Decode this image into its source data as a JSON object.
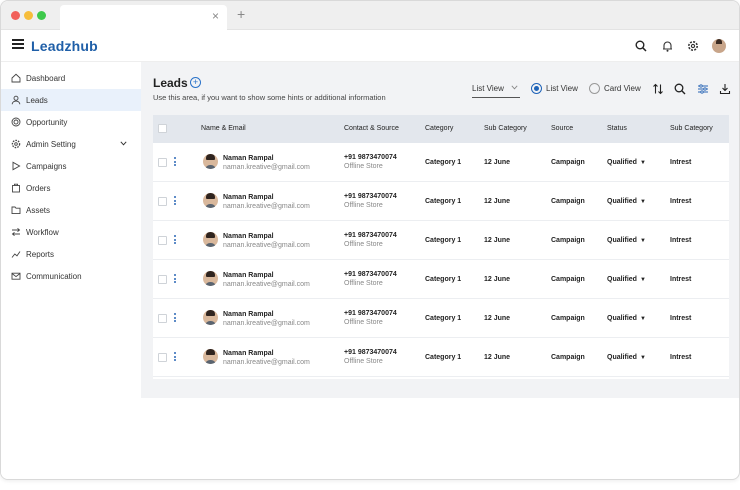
{
  "browser": {
    "dots": [
      "#f1605a",
      "#f6bd3b",
      "#3ec94b"
    ],
    "tab_close": "×",
    "new_tab": "+"
  },
  "app": {
    "logo": "Leadzhub",
    "top_icons": [
      "search-icon",
      "bell-icon",
      "gear-icon",
      "user-avatar"
    ]
  },
  "sidebar": {
    "items": [
      {
        "label": "Dashboard",
        "icon": "home-icon"
      },
      {
        "label": "Leads",
        "icon": "user-icon",
        "active": true
      },
      {
        "label": "Opportunity",
        "icon": "target-icon"
      },
      {
        "label": "Admin Setting",
        "icon": "gear-icon",
        "expandable": true
      },
      {
        "label": "Campaigns",
        "icon": "play-icon"
      },
      {
        "label": "Orders",
        "icon": "box-icon"
      },
      {
        "label": "Assets",
        "icon": "folder-icon"
      },
      {
        "label": "Workflow",
        "icon": "arrows-icon"
      },
      {
        "label": "Reports",
        "icon": "chart-icon"
      },
      {
        "label": "Communication",
        "icon": "mail-icon"
      }
    ]
  },
  "page": {
    "title": "Leads",
    "hint": "Use this area, if you want to show some hints or additional information",
    "view_select": "List View",
    "radio_list": "List View",
    "radio_card": "Card View",
    "selected_view": "list"
  },
  "table": {
    "headers": [
      "Name & Email",
      "Contact & Source",
      "Category",
      "Sub Category",
      "Source",
      "Status",
      "Sub Category"
    ],
    "rows": [
      {
        "name": "Naman Rampal",
        "email": "naman.kreative@gmail.com",
        "phone": "+91 9873470074",
        "contact_source": "Offline Store",
        "category": "Category 1",
        "sub_category": "12 June",
        "source": "Campaign",
        "status": "Qualified",
        "sub_category_2": "Intrest"
      },
      {
        "name": "Naman Rampal",
        "email": "naman.kreative@gmail.com",
        "phone": "+91 9873470074",
        "contact_source": "Offline Store",
        "category": "Category 1",
        "sub_category": "12 June",
        "source": "Campaign",
        "status": "Qualified",
        "sub_category_2": "Intrest"
      },
      {
        "name": "Naman Rampal",
        "email": "naman.kreative@gmail.com",
        "phone": "+91 9873470074",
        "contact_source": "Offline Store",
        "category": "Category 1",
        "sub_category": "12 June",
        "source": "Campaign",
        "status": "Qualified",
        "sub_category_2": "Intrest"
      },
      {
        "name": "Naman Rampal",
        "email": "naman.kreative@gmail.com",
        "phone": "+91 9873470074",
        "contact_source": "Offline Store",
        "category": "Category 1",
        "sub_category": "12 June",
        "source": "Campaign",
        "status": "Qualified",
        "sub_category_2": "Intrest"
      },
      {
        "name": "Naman Rampal",
        "email": "naman.kreative@gmail.com",
        "phone": "+91 9873470074",
        "contact_source": "Offline Store",
        "category": "Category 1",
        "sub_category": "12 June",
        "source": "Campaign",
        "status": "Qualified",
        "sub_category_2": "Intrest"
      },
      {
        "name": "Naman Rampal",
        "email": "naman.kreative@gmail.com",
        "phone": "+91 9873470074",
        "contact_source": "Offline Store",
        "category": "Category 1",
        "sub_category": "12 June",
        "source": "Campaign",
        "status": "Qualified",
        "sub_category_2": "Intrest"
      }
    ]
  },
  "colors": {
    "brand": "#1f5fa8",
    "accent": "#2a72c9",
    "active_nav": "#e9f1fb",
    "table_header": "#e3e7ed",
    "content_bg": "#f2f3f5"
  }
}
